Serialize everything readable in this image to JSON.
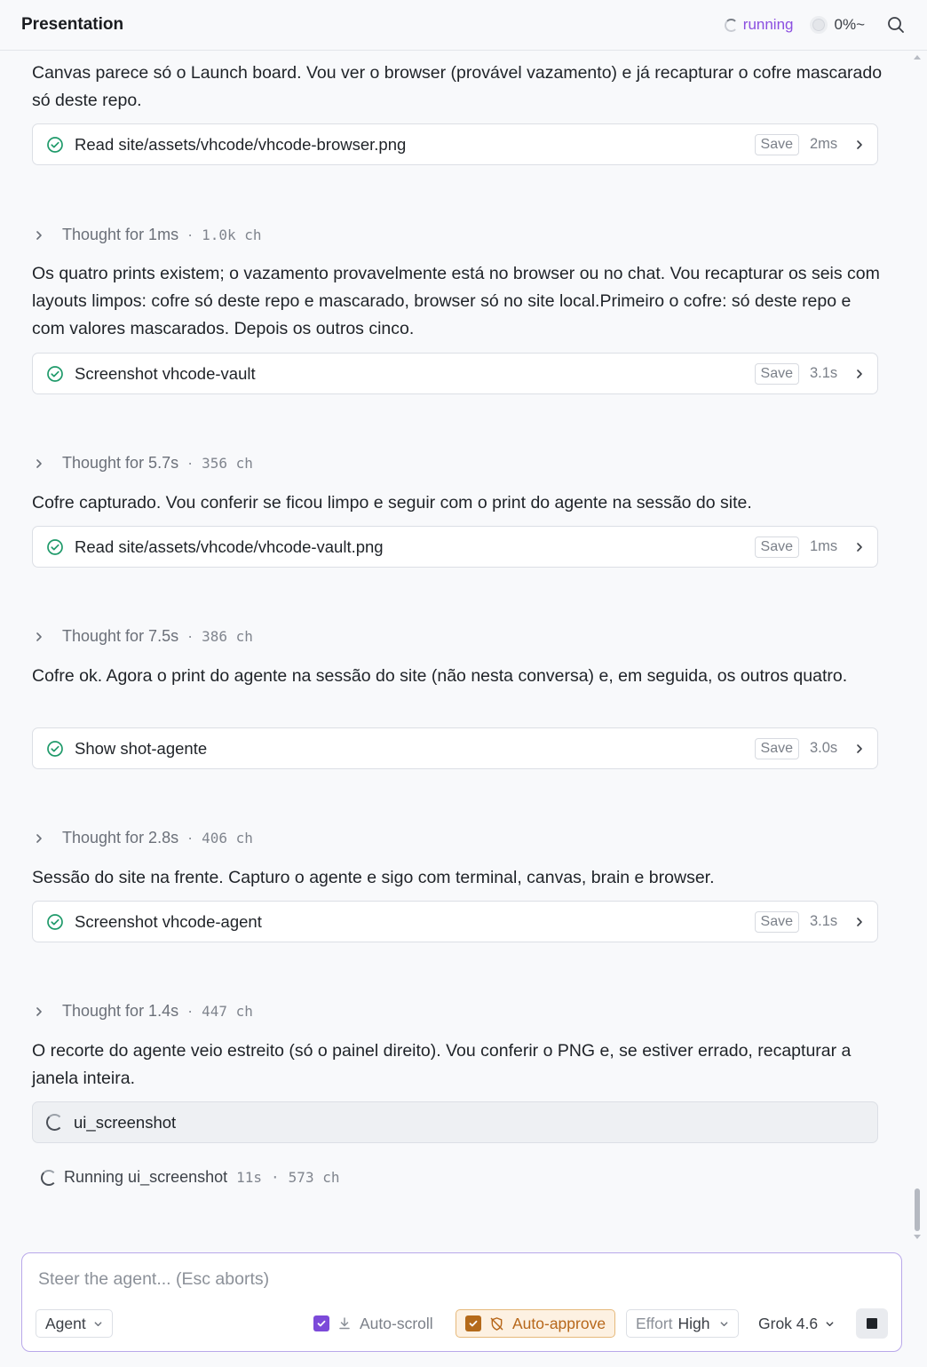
{
  "header": {
    "title": "Presentation",
    "status": "running",
    "progress": "0%~"
  },
  "feed": {
    "intro_text": "Canvas parece só o Launch board. Vou ver o browser (provável vazamento) e já recapturar o cofre mascarado só deste repo.",
    "tool_1": {
      "label": "Read site/assets/vhcode/vhcode-browser.png",
      "save": "Save",
      "duration": "2ms"
    },
    "thought_1": {
      "label": "Thought for 1ms",
      "chars": "1.0k ch"
    },
    "text_1": "Os quatro prints existem; o vazamento provavelmente está no browser ou no chat. Vou recapturar os seis com layouts limpos: cofre só deste repo e mascarado, browser só no site local.Primeiro o cofre: só deste repo e com valores mascarados. Depois os outros cinco.",
    "tool_2": {
      "label": "Screenshot vhcode-vault",
      "save": "Save",
      "duration": "3.1s"
    },
    "thought_2": {
      "label": "Thought for 5.7s",
      "chars": "356 ch"
    },
    "text_2": "Cofre capturado. Vou conferir se ficou limpo e seguir com o print do agente na sessão do site.",
    "tool_3": {
      "label": "Read site/assets/vhcode/vhcode-vault.png",
      "save": "Save",
      "duration": "1ms"
    },
    "thought_3": {
      "label": "Thought for 7.5s",
      "chars": "386 ch"
    },
    "text_3": "Cofre ok. Agora o print do agente na sessão do site (não nesta conversa) e, em seguida, os outros quatro.",
    "tool_4": {
      "label": "Show shot-agente",
      "save": "Save",
      "duration": "3.0s"
    },
    "thought_4": {
      "label": "Thought for 2.8s",
      "chars": "406 ch"
    },
    "text_4": "Sessão do site na frente. Capturo o agente e sigo com terminal, canvas, brain e browser.",
    "tool_5": {
      "label": "Screenshot vhcode-agent",
      "save": "Save",
      "duration": "3.1s"
    },
    "thought_5": {
      "label": "Thought for 1.4s",
      "chars": "447 ch"
    },
    "text_5": "O recorte do agente veio estreito (só o painel direito). Vou conferir o PNG e, se estiver errado, recapturar a janela inteira.",
    "pending_tool": {
      "label": "ui_screenshot"
    },
    "running": {
      "label": "Running ui_screenshot",
      "time": "11s",
      "chars": "573 ch"
    },
    "separator": "·"
  },
  "composer": {
    "placeholder": "Steer the agent... (Esc aborts)",
    "mode": "Agent",
    "autoscroll": "Auto-scroll",
    "autoapprove": "Auto-approve",
    "effort_label": "Effort",
    "effort_value": "High",
    "model": "Grok 4.6"
  },
  "colors": {
    "accent": "#7c4ad9",
    "approve": "#b7671a",
    "check": "#1f9a6a"
  }
}
